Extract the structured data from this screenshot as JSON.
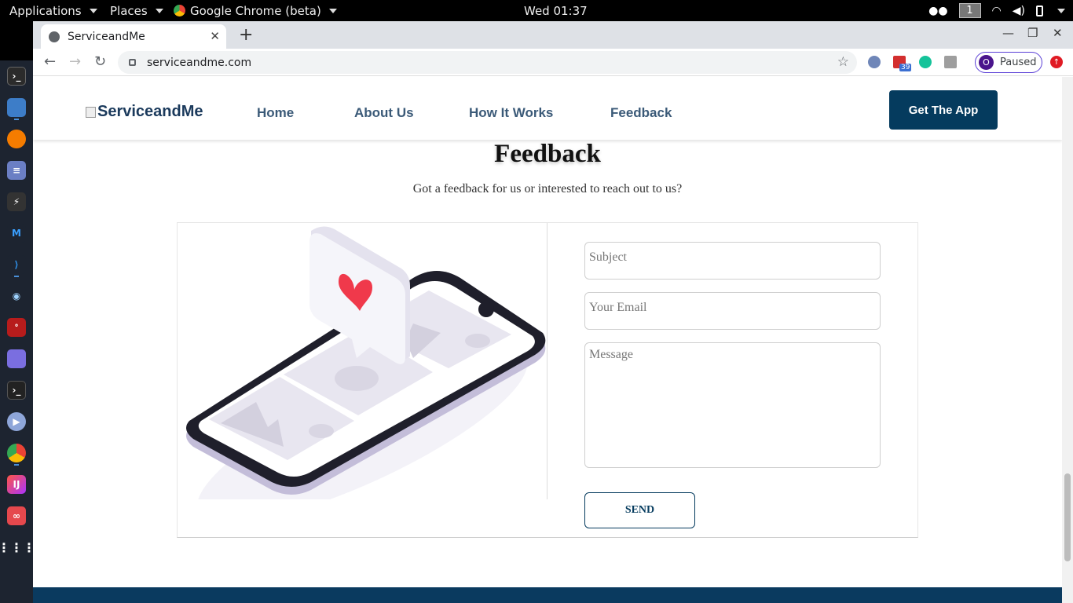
{
  "topbar": {
    "applications": "Applications",
    "places": "Places",
    "chrome_app": "Google Chrome (beta)",
    "clock": "Wed 01:37",
    "workspace": "1"
  },
  "browser": {
    "tab_title": "ServiceandMe",
    "url": "serviceandme.com",
    "profile_initial": "O",
    "profile_status": "Paused",
    "ext_badge": "39"
  },
  "site": {
    "logo_alt": "ServiceandMe",
    "nav": [
      "Home",
      "About Us",
      "How It Works",
      "Feedback"
    ],
    "cta": "Get The App"
  },
  "feedback": {
    "title": "Feedback",
    "subtitle": "Got a feedback for us or interested to reach out to us?",
    "subject_placeholder": "Subject",
    "email_placeholder": "Your Email",
    "message_placeholder": "Message",
    "send": "SEND"
  },
  "colors": {
    "brand_navy": "#053b5e",
    "nav_link": "#3b5a78",
    "heart": "#f0394b"
  }
}
